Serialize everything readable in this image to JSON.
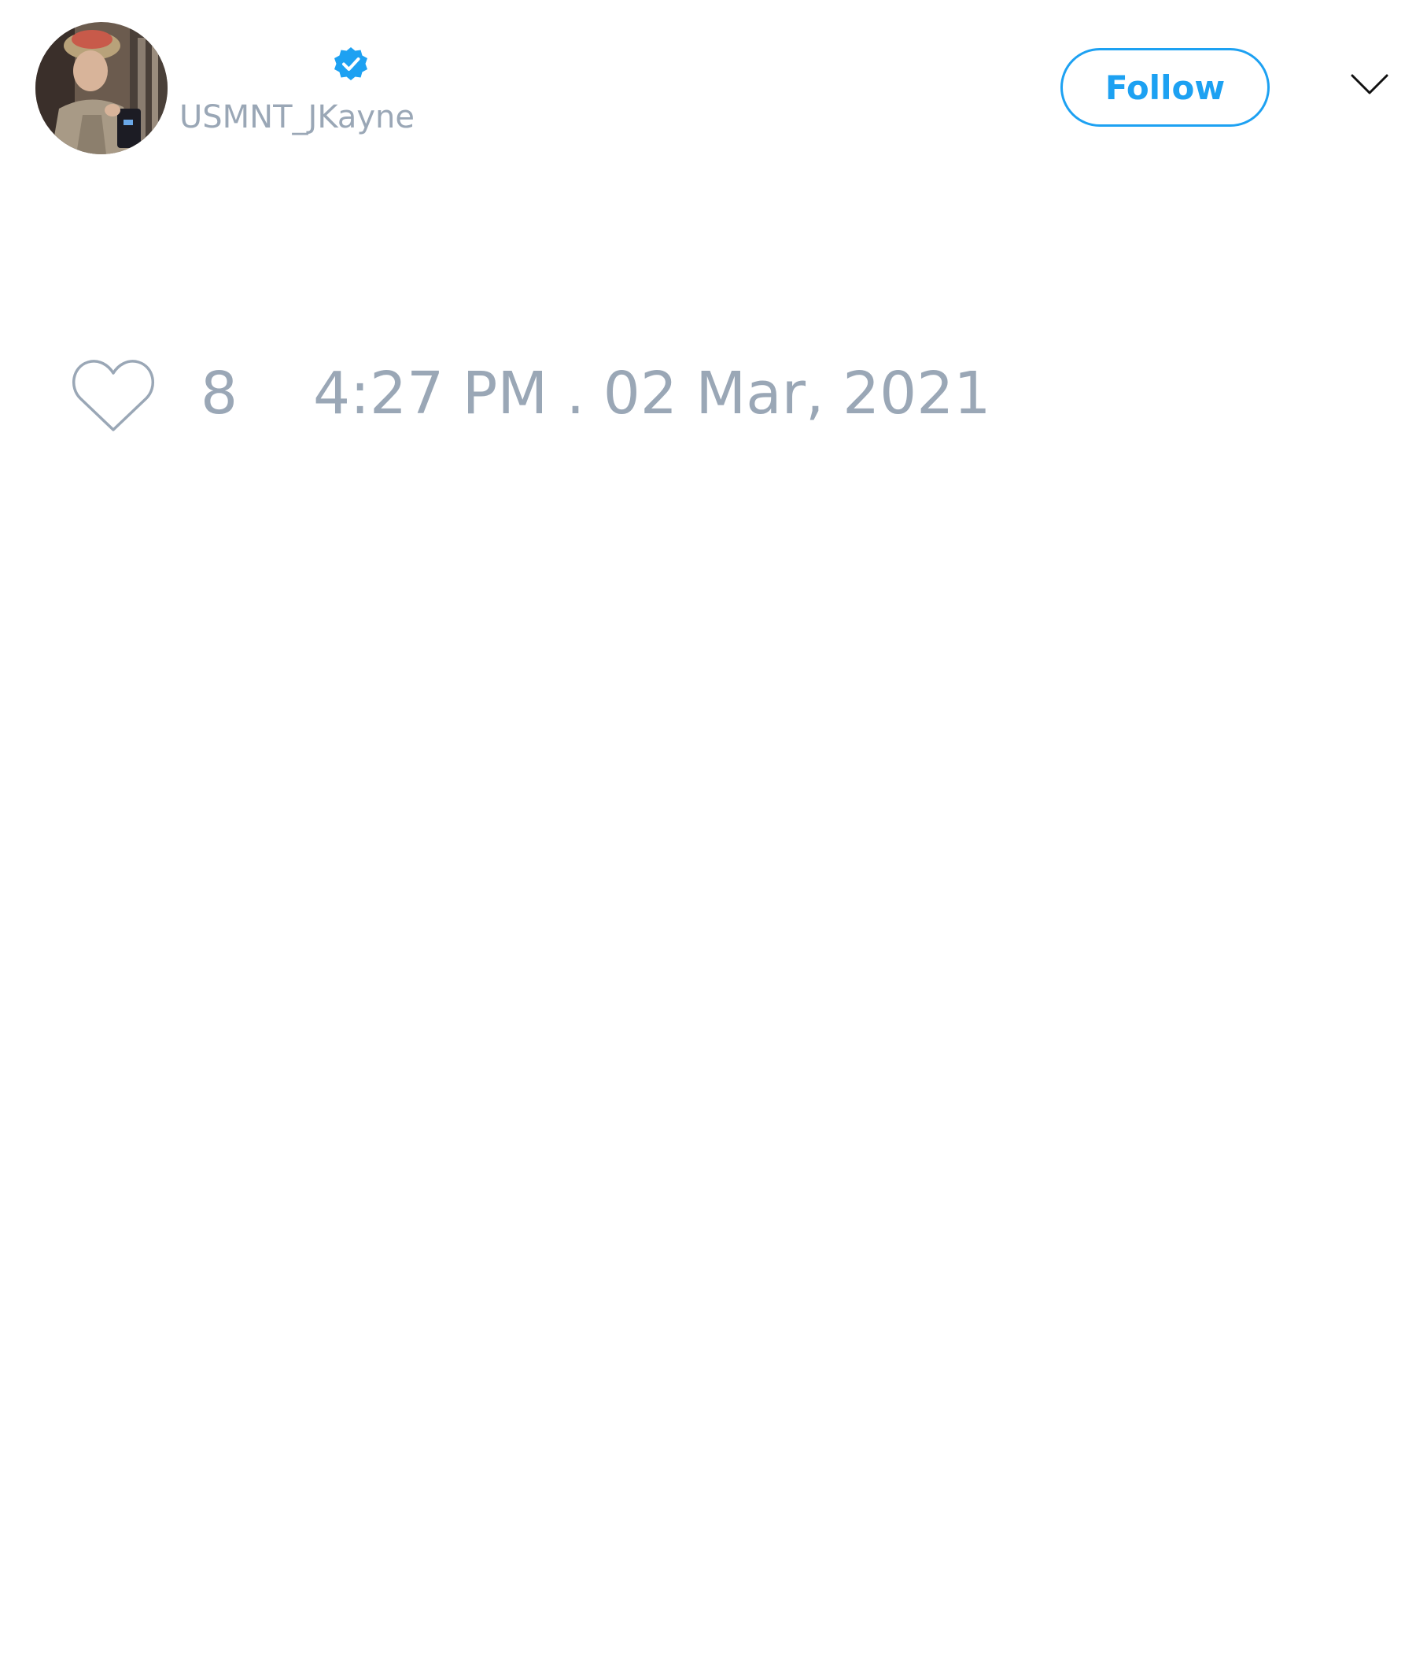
{
  "tweet": {
    "author": {
      "handle": "USMNT_JKayne",
      "verified": true,
      "avatar_icon": "profile-photo"
    },
    "actions": {
      "follow_label": "Follow",
      "menu_icon": "chevron-down-icon"
    },
    "stats": {
      "like_icon": "heart-outline-icon",
      "like_count": "8",
      "timestamp": "4:27 PM . 02 Mar, 2021"
    }
  },
  "colors": {
    "accent": "#1da1f2",
    "muted_text": "#9aa7b6",
    "background": "#ffffff"
  }
}
